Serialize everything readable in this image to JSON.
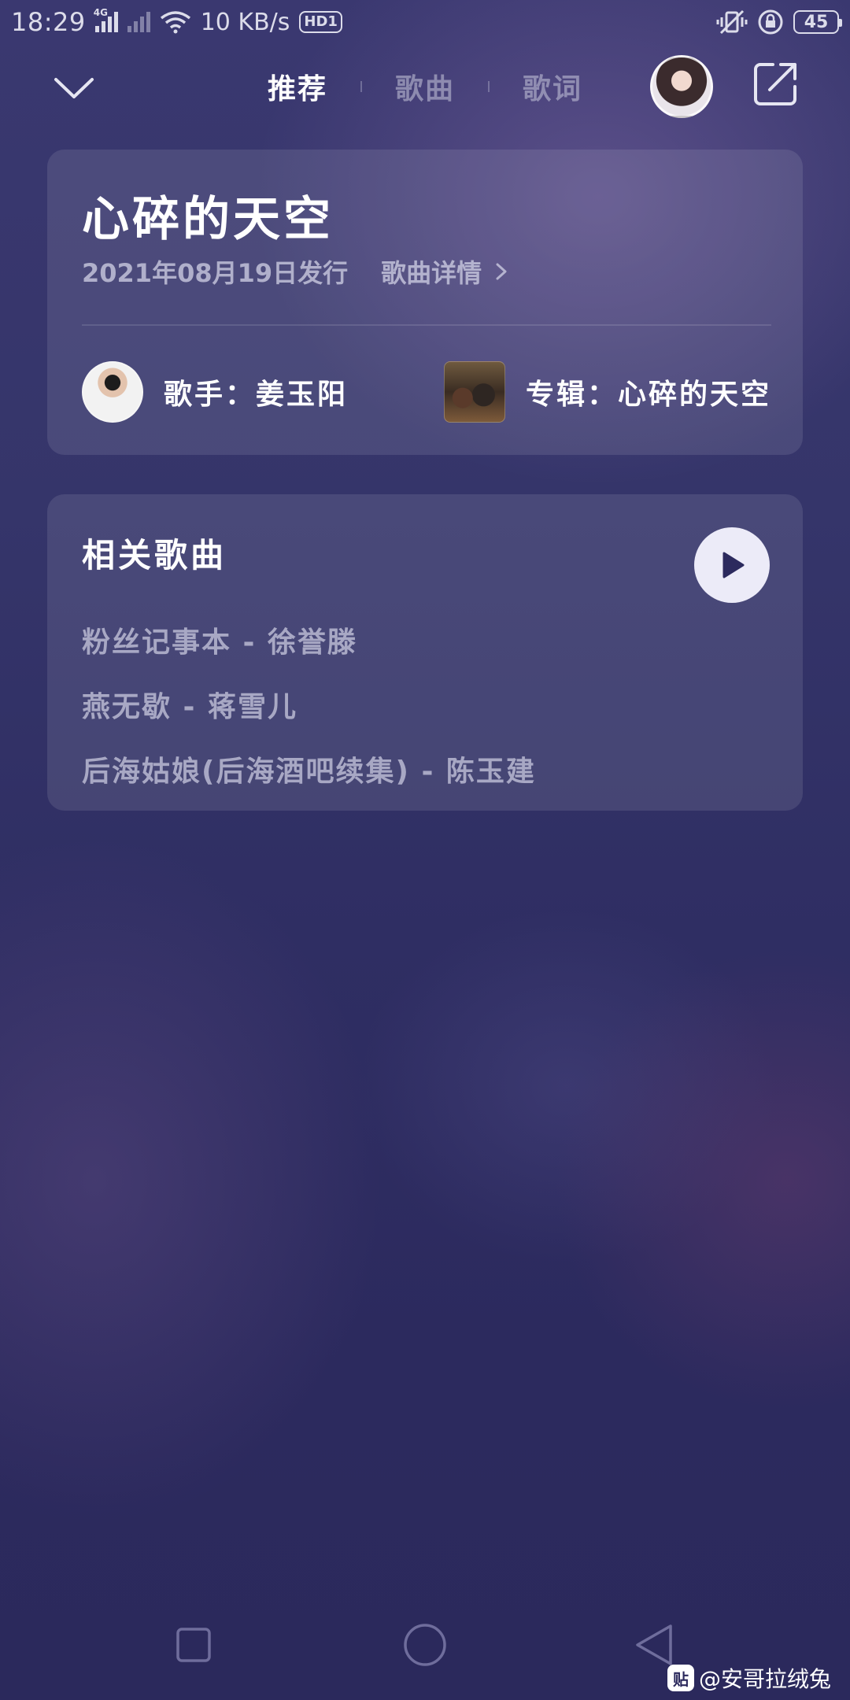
{
  "status_bar": {
    "time": "18:29",
    "network_type": "4G",
    "net_speed": "10 KB/s",
    "hd_badge": "HD1",
    "battery": "45",
    "icons": [
      "signal-icon",
      "signal-off-icon",
      "wifi-icon",
      "vibrate-icon",
      "lock-rotation-icon",
      "battery-icon"
    ]
  },
  "top_nav": {
    "tabs": [
      {
        "label": "推荐",
        "active": true
      },
      {
        "label": "歌曲",
        "active": false
      },
      {
        "label": "歌词",
        "active": false
      }
    ],
    "icons": [
      "chevron-down-icon",
      "avatar",
      "share-icon"
    ]
  },
  "song": {
    "title": "心碎的天空",
    "release": "2021年08月19日发行",
    "detail_label": "歌曲详情",
    "artist_label": "歌手：姜玉阳",
    "album_label": "专辑：心碎的天空"
  },
  "related": {
    "title": "相关歌曲",
    "items": [
      "粉丝记事本 - 徐誉滕",
      "燕无歇 - 蒋雪儿",
      "后海姑娘(后海酒吧续集) - 陈玉建"
    ]
  },
  "watermark": {
    "logo": "贴",
    "text": "@安哥拉绒兔"
  },
  "colors": {
    "background": "#2f2e63",
    "card": "rgba(255,255,255,0.10)",
    "play_button": "#ecebf8"
  }
}
